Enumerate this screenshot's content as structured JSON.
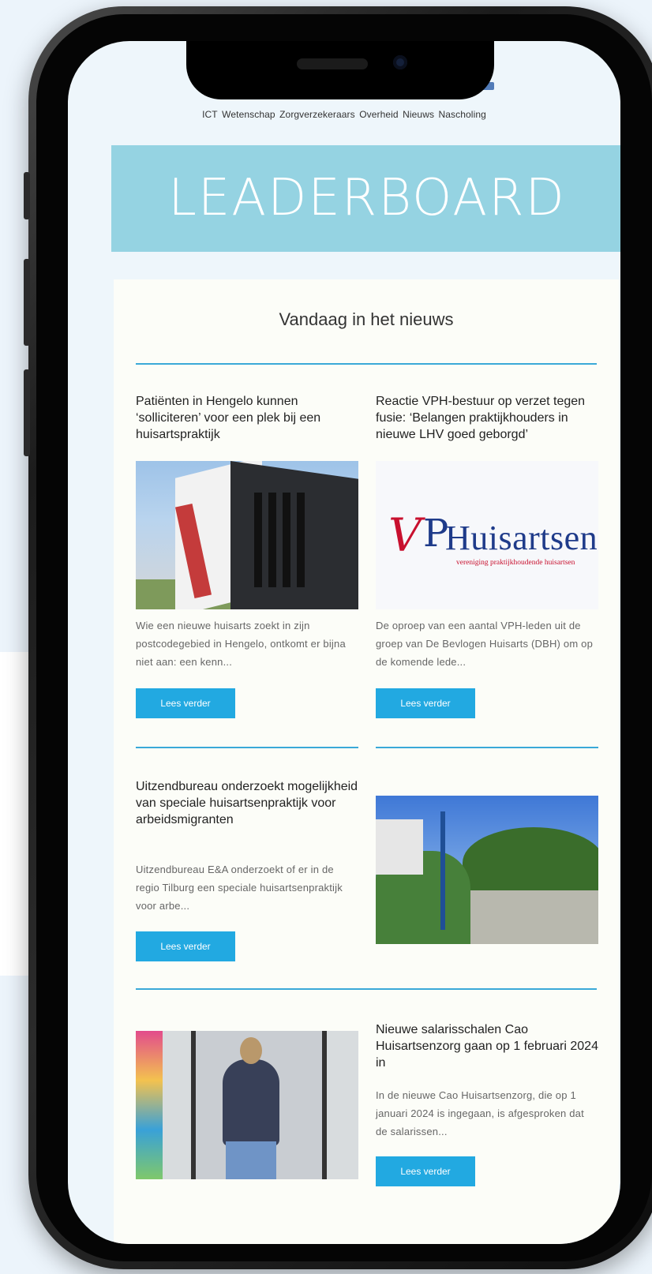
{
  "nav": {
    "items": [
      "ICT",
      "Wetenschap",
      "Zorgverzekeraars",
      "Overheid",
      "Nieuws",
      "Nascholing"
    ]
  },
  "banner": {
    "text": "LEADERBOARD"
  },
  "news": {
    "title": "Vandaag in het nieuws",
    "articles": [
      {
        "title": "Patiënten in Hengelo kunnen ‘solliciteren’ voor een plek bij een huisartspraktijk",
        "excerpt": "Wie een nieuwe huisarts zoekt in zijn postcodegebied in Hengelo, ontkomt er bijna niet aan: een kenn...",
        "button": "Lees verder"
      },
      {
        "title": "Reactie VPH-bestuur op verzet tegen fusie: ‘Belangen praktijkhouders in nieuwe LHV goed geborgd’",
        "excerpt": "De oproep van een aantal VPH-leden uit de groep van De Bevlogen Huisarts (DBH) om op de komende lede...",
        "button": "Lees verder",
        "logo": {
          "mark_v": "V",
          "mark_p": "P",
          "word": "Huisartsen",
          "sub": "vereniging praktijkhoudende huisartsen"
        }
      },
      {
        "title": "Uitzendbureau onderzoekt mogelijkheid van speciale huisartsenpraktijk voor arbeidsmigranten",
        "excerpt": "Uitzendbureau E&A onderzoekt of er in de regio Tilburg een speciale huisartsenpraktijk voor arbe...",
        "button": "Lees verder"
      },
      {
        "title": "Nieuwe salarisschalen Cao Huisartsenzorg gaan op 1 februari 2024 in",
        "excerpt": "In de nieuwe Cao Huisartsenzorg, die op 1 januari 2024 is ingegaan, is afgesproken dat de salarissen...",
        "button": "Lees verder"
      }
    ]
  },
  "colors": {
    "accent": "#22a9e1",
    "banner": "#95d3e2",
    "background": "#ecf4fb"
  }
}
